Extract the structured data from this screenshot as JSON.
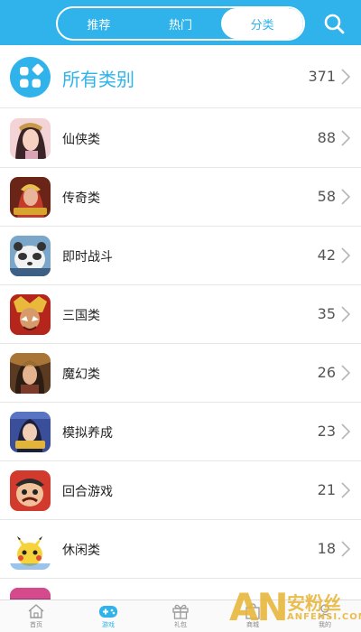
{
  "header": {
    "tabs": [
      {
        "label": "推荐",
        "active": false
      },
      {
        "label": "热门",
        "active": false
      },
      {
        "label": "分类",
        "active": true
      }
    ],
    "search_icon": "search-icon"
  },
  "all_categories": {
    "label": "所有类别",
    "count": "371",
    "icon": "grid-icon"
  },
  "categories": [
    {
      "name": "仙侠类",
      "count": "88"
    },
    {
      "name": "传奇类",
      "count": "58"
    },
    {
      "name": "即时战斗",
      "count": "42"
    },
    {
      "name": "三国类",
      "count": "35"
    },
    {
      "name": "魔幻类",
      "count": "26"
    },
    {
      "name": "模拟养成",
      "count": "23"
    },
    {
      "name": "回合游戏",
      "count": "21"
    },
    {
      "name": "休闲类",
      "count": "18"
    }
  ],
  "bottom_nav": [
    {
      "label": "首页",
      "icon": "home-icon",
      "active": false
    },
    {
      "label": "游戏",
      "icon": "gamepad-icon",
      "active": true
    },
    {
      "label": "礼包",
      "icon": "gift-icon",
      "active": false
    },
    {
      "label": "商城",
      "icon": "store-icon",
      "active": false
    },
    {
      "label": "我的",
      "icon": "profile-icon",
      "active": false
    }
  ],
  "watermark": {
    "big": "AN",
    "cn": "安粉丝",
    "en": "ANFENSI.COM"
  },
  "colors": {
    "accent": "#2fb3ea",
    "divider": "#e6e6e6",
    "watermark": "#e8b63c"
  }
}
